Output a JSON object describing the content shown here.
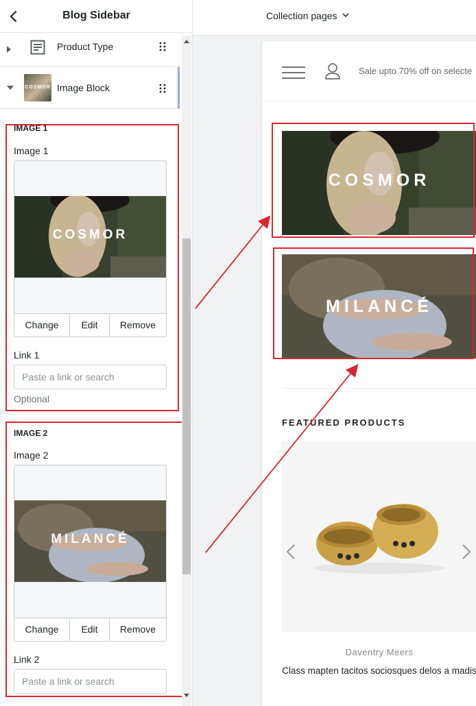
{
  "sidebar": {
    "title": "Blog Sidebar",
    "blocks": [
      {
        "label": "Product Type",
        "icon": "text-block-icon"
      },
      {
        "label": "Image Block",
        "icon": "image-thumbnail",
        "thumb_text": "COSMOR"
      }
    ],
    "image1": {
      "section_title": "IMAGE 1",
      "field_label": "Image 1",
      "image_text": "COSMOR",
      "actions": [
        "Change",
        "Edit",
        "Remove"
      ],
      "link_label": "Link 1",
      "link_placeholder": "Paste a link or search",
      "help": "Optional"
    },
    "image2": {
      "section_title": "IMAGE 2",
      "field_label": "Image 2",
      "image_text": "MILANCÉ",
      "actions": [
        "Change",
        "Edit",
        "Remove"
      ],
      "link_label": "Link 2",
      "link_placeholder": "Paste a link or search"
    }
  },
  "topbar": {
    "template_select": "Collection pages"
  },
  "preview": {
    "announcement": "Sale upto 70% off on selecte",
    "banners": [
      "COSMOR",
      "MILANCÉ"
    ],
    "featured_heading": "FEATURED PRODUCTS",
    "product": {
      "vendor": "Daventry Meers",
      "title": "Class mapten tacitos sociosques delos a madis"
    }
  },
  "colors": {
    "annotation_red": "#d9262f",
    "panel_border": "#e1e3e5",
    "gold": "#c8a24a"
  }
}
